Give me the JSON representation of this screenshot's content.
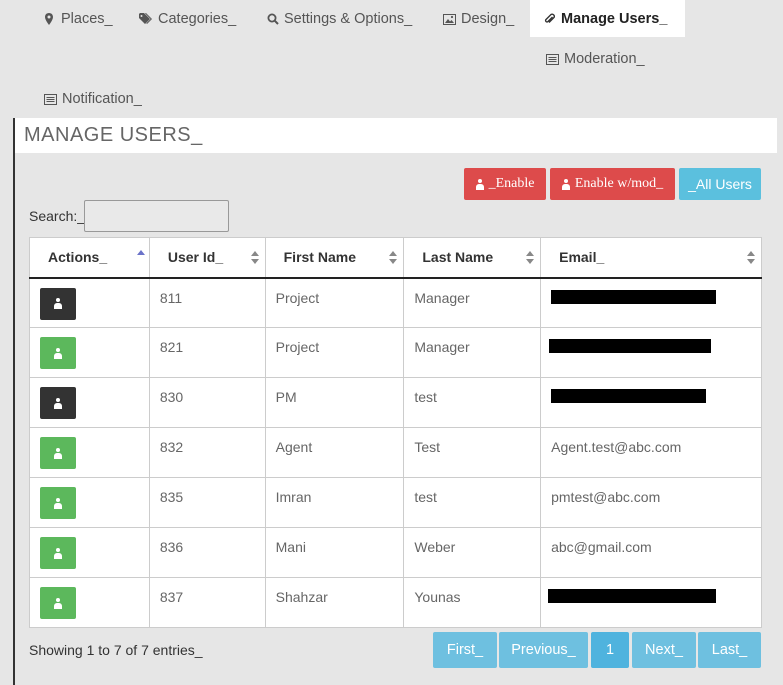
{
  "tabs": {
    "places": "Places_",
    "categories": "Categories_",
    "settings": "Settings & Options_",
    "design": "Design_",
    "manage_users": "Manage Users_",
    "moderation": "Moderation_",
    "notification": "Notification_"
  },
  "panel": {
    "title": "MANAGE USERS_"
  },
  "buttons": {
    "enable": "_Enable",
    "enable_mod": "Enable w/mod_",
    "all_users": "_All Users"
  },
  "search": {
    "label": "Search:_",
    "value": ""
  },
  "table": {
    "headers": {
      "actions": "Actions_",
      "user_id": "User Id_",
      "first_name": "First Name",
      "last_name": "Last Name",
      "email": "Email_"
    },
    "rows": [
      {
        "id": "811",
        "first": "Project",
        "last": "Manager",
        "email": "",
        "email_redacted": true,
        "action": "dark"
      },
      {
        "id": "821",
        "first": "Project",
        "last": "Manager",
        "email": "",
        "email_redacted": true,
        "action": "green"
      },
      {
        "id": "830",
        "first": "PM",
        "last": "test",
        "email": "",
        "email_redacted": true,
        "action": "dark"
      },
      {
        "id": "832",
        "first": "Agent",
        "last": "Test",
        "email": "Agent.test@abc.com",
        "email_redacted": false,
        "action": "green"
      },
      {
        "id": "835",
        "first": "Imran",
        "last": "test",
        "email": "pmtest@abc.com",
        "email_redacted": false,
        "action": "green"
      },
      {
        "id": "836",
        "first": "Mani",
        "last": "Weber",
        "email": "abc@gmail.com",
        "email_redacted": false,
        "action": "green"
      },
      {
        "id": "837",
        "first": "Shahzar",
        "last": "Younas",
        "email": "",
        "email_redacted": true,
        "action": "green"
      }
    ]
  },
  "footer": {
    "info": "Showing 1 to 7 of 7 entries_"
  },
  "pagination": {
    "first": "First_",
    "previous": "Previous_",
    "current": "1",
    "next": "Next_",
    "last": "Last_"
  },
  "colors": {
    "red": "#dd4b4b",
    "blue": "#5bc0de",
    "green": "#5cb85c",
    "dark": "#333333"
  }
}
